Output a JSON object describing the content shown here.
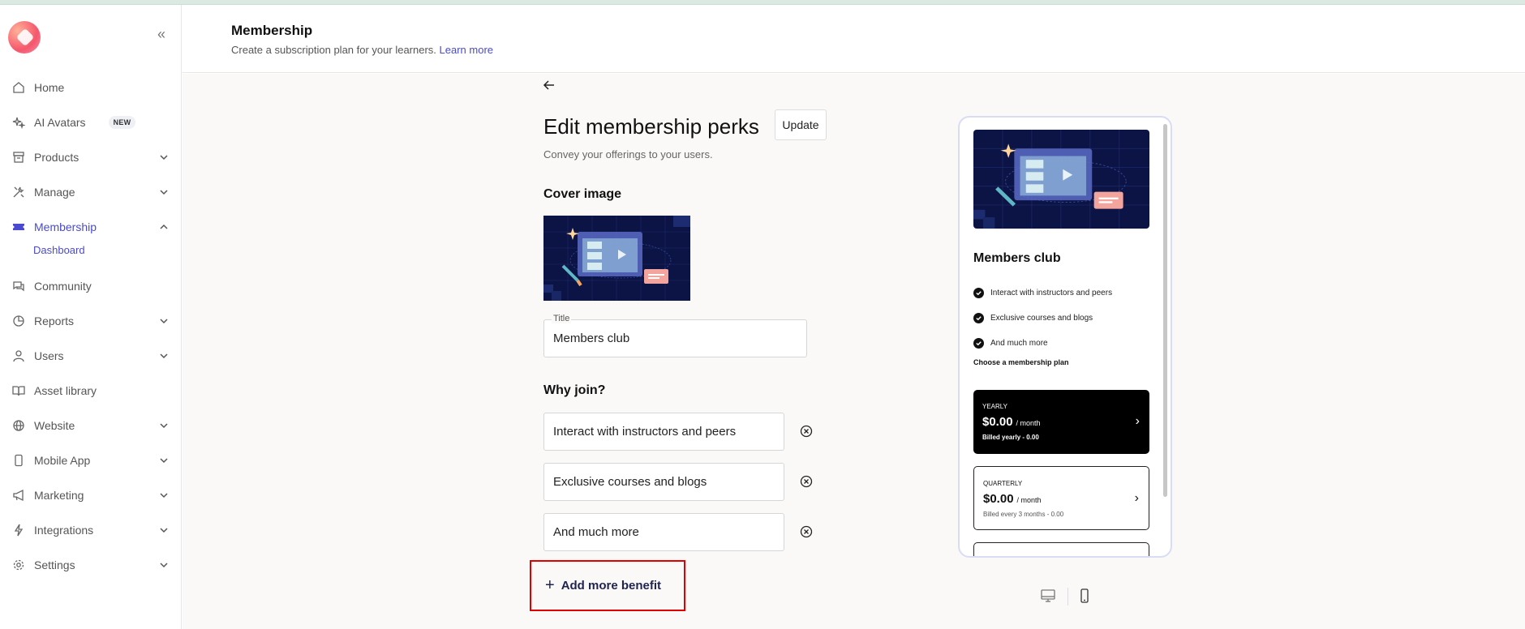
{
  "sidebar": {
    "items": [
      {
        "label": "Home",
        "icon": "home-icon"
      },
      {
        "label": "AI Avatars",
        "icon": "sparkle-icon",
        "badge": "NEW"
      },
      {
        "label": "Products",
        "icon": "box-icon"
      },
      {
        "label": "Manage",
        "icon": "tools-icon"
      },
      {
        "label": "Membership",
        "icon": "ticket-icon"
      },
      {
        "label": "Community",
        "icon": "chat-icon"
      },
      {
        "label": "Reports",
        "icon": "pie-chart-icon"
      },
      {
        "label": "Users",
        "icon": "user-icon"
      },
      {
        "label": "Asset library",
        "icon": "book-icon"
      },
      {
        "label": "Website",
        "icon": "globe-icon"
      },
      {
        "label": "Mobile App",
        "icon": "phone-icon"
      },
      {
        "label": "Marketing",
        "icon": "megaphone-icon"
      },
      {
        "label": "Integrations",
        "icon": "plug-icon"
      },
      {
        "label": "Settings",
        "icon": "gear-icon"
      }
    ],
    "subitem": "Dashboard",
    "active_color": "#4a4ad1"
  },
  "header": {
    "title": "Membership",
    "subtitle": "Create a subscription plan for your learners.",
    "link": "Learn more"
  },
  "editor": {
    "title": "Edit membership perks",
    "update_label": "Update",
    "description": "Convey your offerings to your users.",
    "cover_label": "Cover image",
    "title_field_label": "Title",
    "title_value": "Members club",
    "why_join_label": "Why join?",
    "benefits": [
      "Interact with instructors and peers",
      "Exclusive courses and blogs",
      "And much more"
    ],
    "add_benefit_label": "Add more benefit"
  },
  "preview": {
    "title": "Members club",
    "benefits": [
      "Interact with instructors and peers",
      "Exclusive courses and blogs",
      "And much more"
    ],
    "choose_label": "Choose a membership plan",
    "plans": [
      {
        "name": "YEARLY",
        "price": "$0.00",
        "per": "/ month",
        "billed": "Billed yearly - 0.00"
      },
      {
        "name": "QUARTERLY",
        "price": "$0.00",
        "per": "/ month",
        "billed": "Billed every 3 months - 0.00"
      }
    ]
  }
}
